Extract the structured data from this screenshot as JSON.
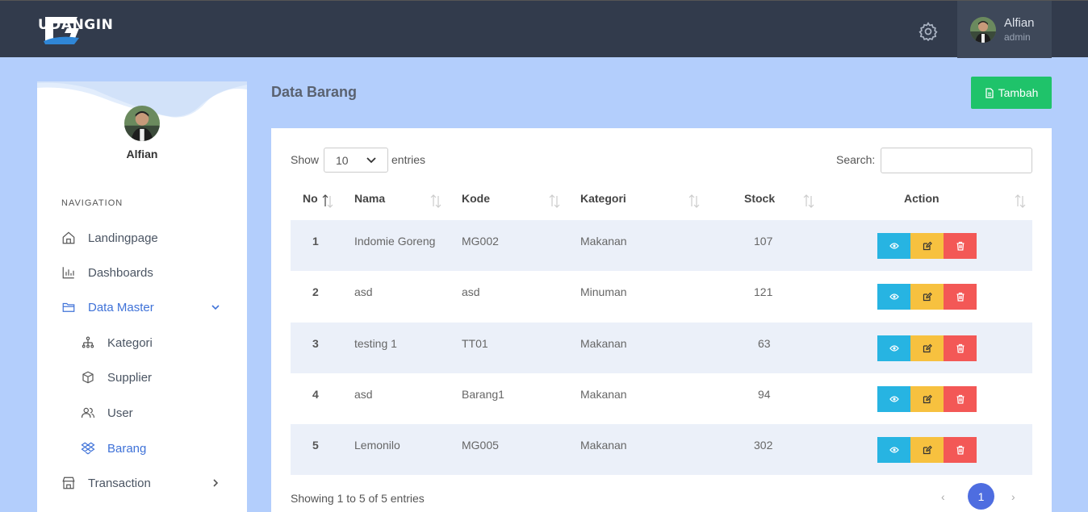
{
  "app": {
    "brand": "UDANGIN",
    "accent_color": "#1fc36a",
    "primary_color": "#4e6de0"
  },
  "topbar": {
    "settings_icon": "gear-icon",
    "user": {
      "name": "Alfian",
      "role": "admin"
    }
  },
  "sidebar": {
    "profile_name": "Alfian",
    "nav_heading": "NAVIGATION",
    "items": [
      {
        "label": "Landingpage",
        "icon": "home-icon"
      },
      {
        "label": "Dashboards",
        "icon": "bar-chart-icon"
      },
      {
        "label": "Data Master",
        "icon": "folder-icon",
        "expanded": true
      },
      {
        "label": "Kategori",
        "icon": "hierarchy-icon"
      },
      {
        "label": "Supplier",
        "icon": "box-icon"
      },
      {
        "label": "User",
        "icon": "users-icon"
      },
      {
        "label": "Barang",
        "icon": "dropbox-icon",
        "active": true
      },
      {
        "label": "Transaction",
        "icon": "store-icon"
      }
    ]
  },
  "page": {
    "title": "Data Barang",
    "add_button": "Tambah"
  },
  "table": {
    "show_label": "Show",
    "page_size": "10",
    "entries_label": "entries",
    "search_label": "Search:",
    "search_value": "",
    "columns": [
      "No",
      "Nama",
      "Kode",
      "Kategori",
      "Stock",
      "Action"
    ],
    "rows": [
      {
        "no": "1",
        "nama": "Indomie Goreng",
        "kode": "MG002",
        "kategori": "Makanan",
        "stock": "107"
      },
      {
        "no": "2",
        "nama": "asd",
        "kode": "asd",
        "kategori": "Minuman",
        "stock": "121"
      },
      {
        "no": "3",
        "nama": "testing 1",
        "kode": "TT01",
        "kategori": "Makanan",
        "stock": "63"
      },
      {
        "no": "4",
        "nama": "asd",
        "kode": "Barang1",
        "kategori": "Makanan",
        "stock": "94"
      },
      {
        "no": "5",
        "nama": "Lemonilo",
        "kode": "MG005",
        "kategori": "Makanan",
        "stock": "302"
      }
    ],
    "info": "Showing 1 to 5 of 5 entries",
    "pagination": {
      "prev": "‹",
      "current": "1",
      "next": "›"
    }
  }
}
